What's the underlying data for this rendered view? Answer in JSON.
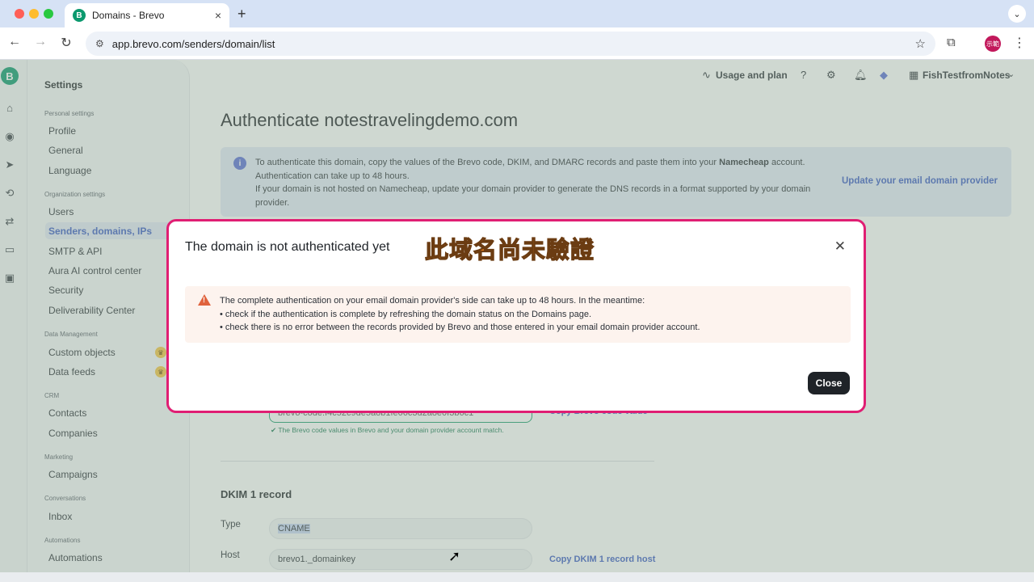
{
  "browser": {
    "tab_title": "Domains - Brevo",
    "tab_favicon": "B",
    "tab_close": "×",
    "new_tab": "+",
    "url": "app.brevo.com/senders/domain/list",
    "profile_label": "示範"
  },
  "sidebar": {
    "title": "Settings",
    "sections": [
      {
        "label": "Personal settings",
        "items": [
          "Profile",
          "General",
          "Language"
        ]
      },
      {
        "label": "Organization settings",
        "items": [
          "Users",
          "Senders, domains, IPs",
          "SMTP & API",
          "Aura AI control center",
          "Security",
          "Deliverability Center"
        ]
      },
      {
        "label": "Data Management",
        "items": [
          "Custom objects",
          "Data feeds"
        ]
      },
      {
        "label": "CRM",
        "items": [
          "Contacts",
          "Companies"
        ]
      },
      {
        "label": "Marketing",
        "items": [
          "Campaigns"
        ]
      },
      {
        "label": "Conversations",
        "items": [
          "Inbox"
        ]
      },
      {
        "label": "Automations",
        "items": [
          "Automations"
        ]
      }
    ],
    "active_item": "Senders, domains, IPs"
  },
  "topnav": {
    "usage_label": "Usage and plan",
    "account_label": "FishTestfromNotes"
  },
  "main": {
    "page_title": "Authenticate notestravelingdemo.com",
    "info_line1_pre": "To authenticate this domain, copy the values of the Brevo code, DKIM, and DMARC records and paste them into your ",
    "info_provider": "Namecheap",
    "info_line1_post": " account.",
    "info_line2": "Authentication can take up to 48 hours.",
    "info_line3": "If your domain is not hosted on Namecheap, update your domain provider to generate the DNS records in a format supported by your domain provider.",
    "info_link": "Update your email domain provider",
    "brevo_code_value": "brevo-code:f4c52c9de5a8b1fe06c3d2a8e0f3b6c1",
    "copy_code_link": "Copy Brevo code value",
    "match_note": "The Brevo code values in Brevo and your domain provider account match.",
    "dkim_title": "DKIM 1 record",
    "type_label": "Type",
    "type_value": "CNAME",
    "host_label": "Host",
    "host_value": "brevo1._domainkey",
    "copy_host_link": "Copy DKIM 1 record host"
  },
  "modal": {
    "title": "The domain is not authenticated yet",
    "annotation": "此域名尚未驗證",
    "warning_intro": "The complete authentication on your email domain provider's side can take up to 48 hours. In the meantime:",
    "bullet1": "• check if the authentication is complete by refreshing the domain status on the Domains page.",
    "bullet2": "• check there is no error between the records provided by Brevo and those entered in your email domain provider account.",
    "close_label": "Close"
  },
  "colors": {
    "brand_green": "#0b996e",
    "link_blue": "#3b5cc4",
    "modal_border": "#e01e73",
    "annotation_orange": "#ff8a1f",
    "warning": "#e0623c"
  }
}
